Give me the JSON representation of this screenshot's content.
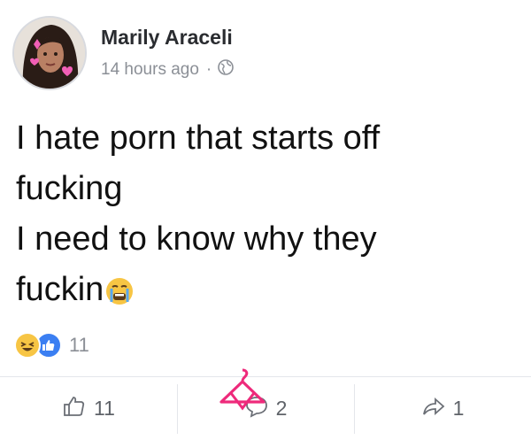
{
  "post": {
    "author": "Marily Araceli",
    "timestamp": "14 hours ago",
    "separator": "·",
    "privacy_icon": "globe-icon",
    "lines": [
      "I hate porn that starts off",
      "fucking",
      "I need to know why they",
      "fuckin"
    ],
    "trailing_emoji": "crying-face-emoji"
  },
  "reactions": {
    "icons": [
      "haha-icon",
      "like-icon"
    ],
    "count": "11"
  },
  "actions": {
    "like_count": "11",
    "comment_count": "2",
    "share_count": "1"
  },
  "colors": {
    "like_blue": "#3b7ff2",
    "haha_yellow": "#f7c544",
    "meta_gray": "#8b8f96",
    "watermark_pink": "#ee2a7b"
  }
}
